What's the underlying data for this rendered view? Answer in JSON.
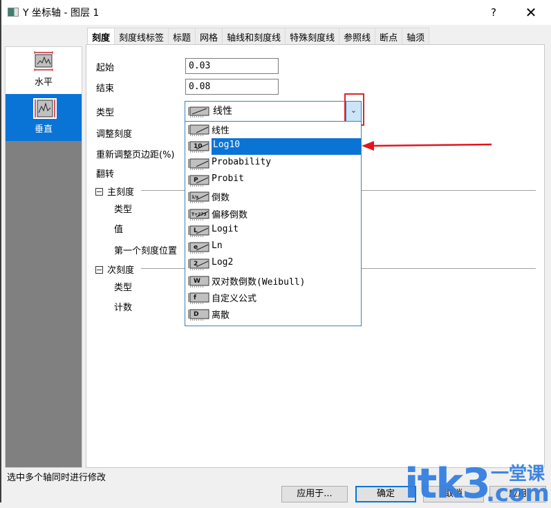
{
  "window": {
    "title": "Y 坐标轴 - 图层 1",
    "help_label": "?",
    "close_label": "✕"
  },
  "left_panel": {
    "items": [
      {
        "label": "水平",
        "icon": "horizontal-axis-icon",
        "selected": false
      },
      {
        "label": "垂直",
        "icon": "vertical-axis-icon",
        "selected": true
      }
    ]
  },
  "tabs": [
    {
      "label": "刻度",
      "active": true
    },
    {
      "label": "刻度线标签",
      "active": false
    },
    {
      "label": "标题",
      "active": false
    },
    {
      "label": "网格",
      "active": false
    },
    {
      "label": "轴线和刻度线",
      "active": false
    },
    {
      "label": "特殊刻度线",
      "active": false
    },
    {
      "label": "参照线",
      "active": false
    },
    {
      "label": "断点",
      "active": false
    },
    {
      "label": "轴须",
      "active": false
    }
  ],
  "form": {
    "start_label": "起始",
    "start_value": "0.03",
    "end_label": "结束",
    "end_value": "0.08",
    "type_label": "类型",
    "type_value": "线性",
    "rescale_label": "调整刻度",
    "rescale_margin_label": "重新调整页边距(%)",
    "reverse_label": "翻转",
    "major_section": "主刻度",
    "major_type_label": "类型",
    "major_value_label": "值",
    "first_tick_label": "第一个刻度位置",
    "minor_section": "次刻度",
    "minor_type_label": "类型",
    "minor_count_label": "计数"
  },
  "dropdown": {
    "options": [
      {
        "label": "线性",
        "icon": "linear-scale-icon",
        "glyph": ""
      },
      {
        "label": "Log10",
        "icon": "log10-scale-icon",
        "glyph": "10",
        "highlighted": true
      },
      {
        "label": "Probability",
        "icon": "probability-scale-icon",
        "glyph": ""
      },
      {
        "label": "Probit",
        "icon": "probit-scale-icon",
        "glyph": "P"
      },
      {
        "label": "倒数",
        "icon": "reciprocal-scale-icon",
        "glyph": "1/x"
      },
      {
        "label": "偏移倒数",
        "icon": "offset-reciprocal-scale-icon",
        "glyph": "T+273"
      },
      {
        "label": "Logit",
        "icon": "logit-scale-icon",
        "glyph": "L"
      },
      {
        "label": "Ln",
        "icon": "ln-scale-icon",
        "glyph": "e"
      },
      {
        "label": "Log2",
        "icon": "log2-scale-icon",
        "glyph": "2"
      },
      {
        "label": "双对数倒数(Weibull)",
        "icon": "weibull-scale-icon",
        "glyph": "W"
      },
      {
        "label": "自定义公式",
        "icon": "custom-formula-scale-icon",
        "glyph": "f"
      },
      {
        "label": "离散",
        "icon": "discrete-scale-icon",
        "glyph": "D"
      }
    ]
  },
  "status_text": "选中多个轴同时进行修改",
  "buttons": {
    "apply_to": "应用于...",
    "ok": "确定",
    "cancel": "取消",
    "apply": "应用"
  },
  "annotation": {
    "highlight_color": "#d9252b",
    "arrow_color": "#e0161c"
  },
  "watermark": {
    "main": "itk3",
    "cn": "一堂课",
    "com": ".com",
    "color": "#2f7de1"
  }
}
